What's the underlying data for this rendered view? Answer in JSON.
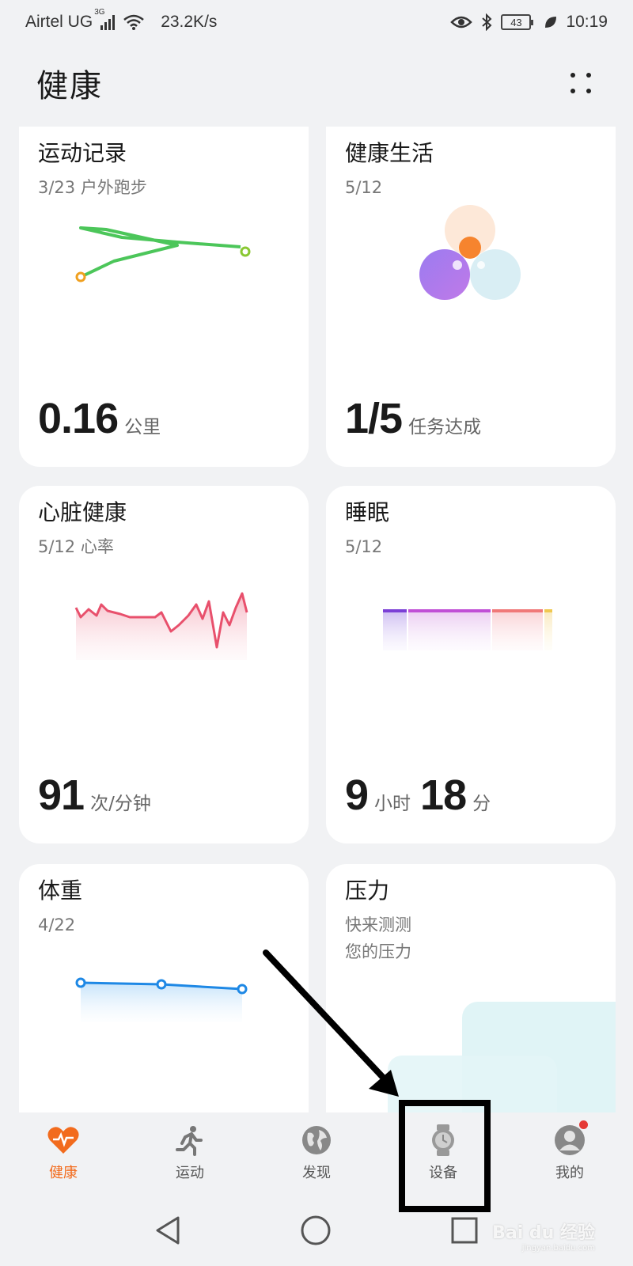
{
  "status_bar": {
    "carrier": "Airtel UG",
    "network": "3G",
    "speed": "23.2K/s",
    "battery": "43",
    "time": "10:19"
  },
  "header": {
    "title": "健康",
    "menu_icon": "more-grid-icon"
  },
  "cards": {
    "exercise": {
      "title": "运动记录",
      "sub": "3/23 户外跑步",
      "value": "0.16",
      "unit": "公里"
    },
    "healthy_living": {
      "title": "健康生活",
      "sub": "5/12",
      "value": "1/5",
      "unit": "任务达成"
    },
    "heart": {
      "title": "心脏健康",
      "sub": "5/12 心率",
      "value": "91",
      "unit": "次/分钟"
    },
    "sleep": {
      "title": "睡眠",
      "sub": "5/12",
      "hours": "9",
      "hours_unit": "小时",
      "minutes": "18",
      "minutes_unit": "分"
    },
    "weight": {
      "title": "体重",
      "sub": "4/22"
    },
    "stress": {
      "title": "压力",
      "sub_line1": "快来测测",
      "sub_line2": "您的压力"
    }
  },
  "tabs": [
    {
      "label": "健康",
      "icon": "heart-icon",
      "active": true
    },
    {
      "label": "运动",
      "icon": "runner-icon",
      "active": false
    },
    {
      "label": "发现",
      "icon": "globe-icon",
      "active": false
    },
    {
      "label": "设备",
      "icon": "watch-icon",
      "active": false
    },
    {
      "label": "我的",
      "icon": "profile-icon",
      "active": false
    }
  ],
  "nav": {
    "back": "back-triangle-icon",
    "home": "home-circle-icon",
    "recents": "recents-square-icon"
  },
  "watermark": {
    "text": "Bai du 经验",
    "url": "jingyan.baidu.com"
  },
  "colors": {
    "accent": "#f26b1d",
    "route": "#4cc65a",
    "heart_line": "#e8506c",
    "weight_line": "#1e88e5"
  }
}
